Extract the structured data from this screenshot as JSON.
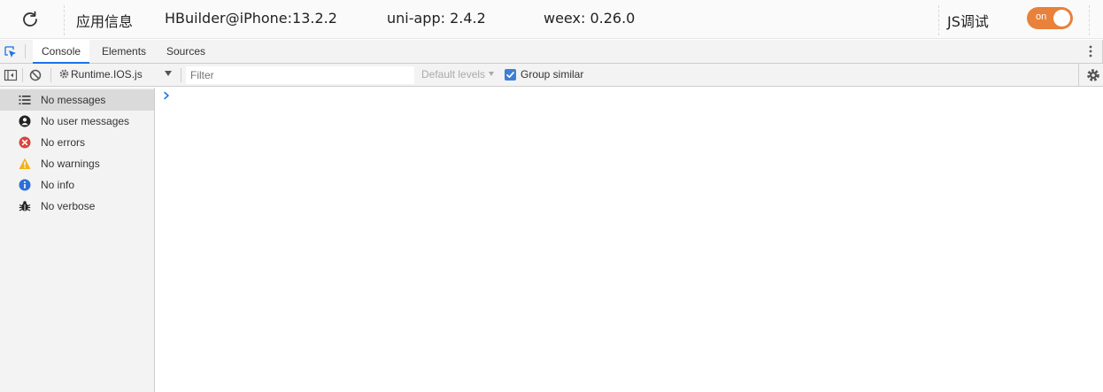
{
  "topbar": {
    "app_name": "应用信息",
    "device": "HBuilder@iPhone:13.2.2",
    "uniapp": "uni-app: 2.4.2",
    "weex": "weex: 0.26.0",
    "js_debug_label": "JS调试",
    "toggle_label": "on",
    "toggle_color": "#e9813a"
  },
  "tabs": [
    {
      "label": "Console",
      "active": true
    },
    {
      "label": "Elements",
      "active": false
    },
    {
      "label": "Sources",
      "active": false
    }
  ],
  "toolbar": {
    "context": "Runtime.IOS.js",
    "filter_placeholder": "Filter",
    "levels": "Default levels",
    "group_similar": "Group similar",
    "group_similar_checked": true,
    "accent": "#1a73e8"
  },
  "sidebar": {
    "items": [
      {
        "label": "No messages",
        "icon": "list-icon"
      },
      {
        "label": "No user messages",
        "icon": "user-icon"
      },
      {
        "label": "No errors",
        "icon": "error-icon"
      },
      {
        "label": "No warnings",
        "icon": "warning-icon"
      },
      {
        "label": "No info",
        "icon": "info-icon"
      },
      {
        "label": "No verbose",
        "icon": "bug-icon"
      }
    ]
  },
  "console": {
    "prompt_symbol": "›"
  }
}
